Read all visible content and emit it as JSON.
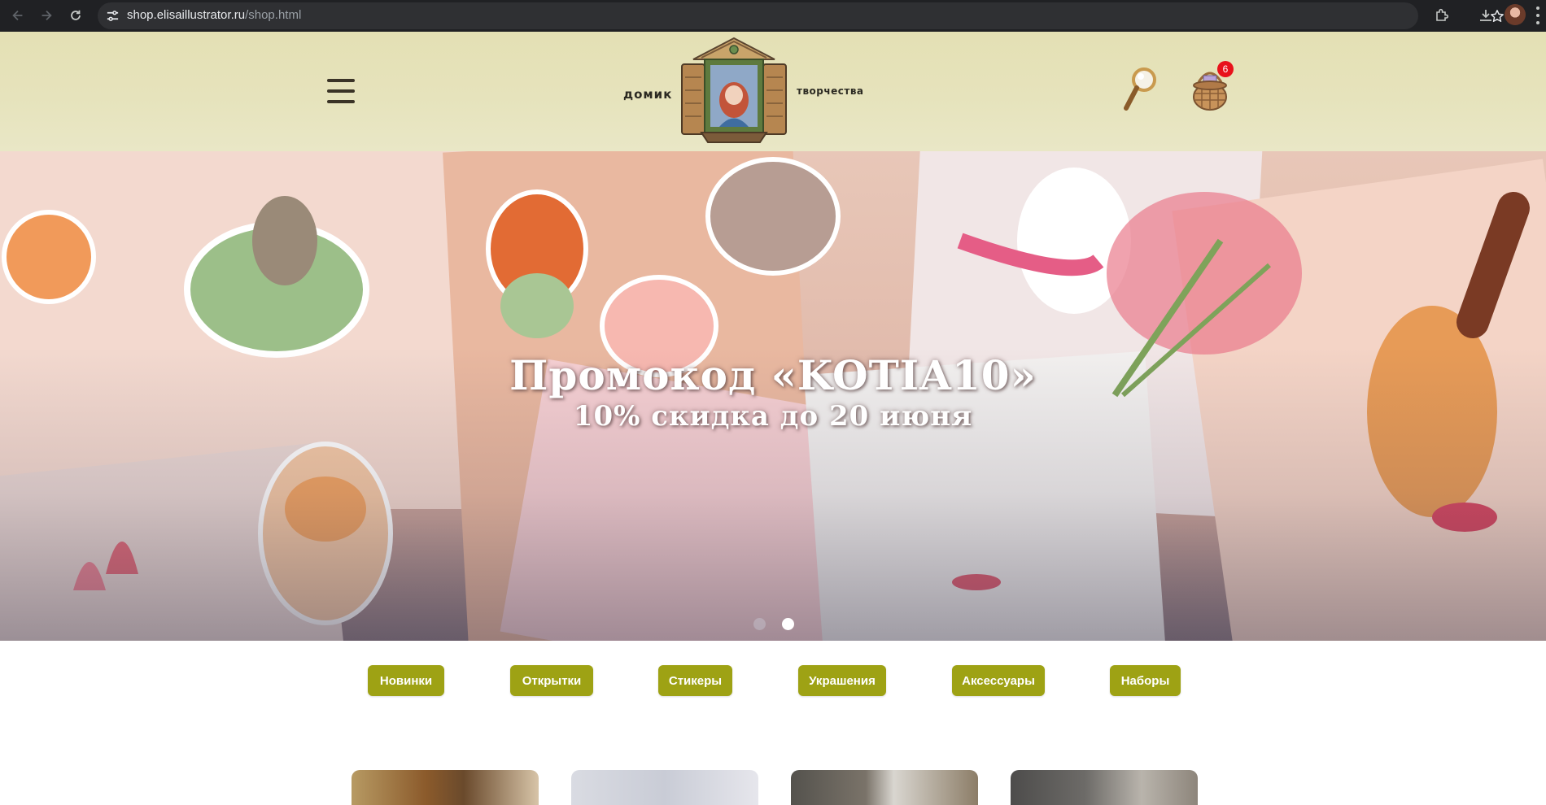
{
  "browser": {
    "url_host": "shop.elisaillustrator.ru",
    "url_path": "/shop.html",
    "icons": [
      "back-arrow-icon",
      "forward-arrow-icon",
      "reload-icon",
      "site-settings-icon",
      "bookmark-star-icon",
      "extensions-icon",
      "download-icon",
      "profile-avatar",
      "more-menu-icon"
    ]
  },
  "header": {
    "logo_left": "домик",
    "logo_right": "творчества",
    "cart_count": "6",
    "icons": [
      "hamburger-menu-icon",
      "magnifier-search-icon",
      "basket-cart-icon"
    ]
  },
  "hero": {
    "title": "Промокод «KOTIA10»",
    "subtitle": "10% скидка до 20 июня",
    "slides_total": 2,
    "active_slide": 2
  },
  "categories": [
    "Новинки",
    "Открытки",
    "Стикеры",
    "Украшения",
    "Аксессуары",
    "Наборы"
  ],
  "colors": {
    "chrome_bg": "#202124",
    "header_bg": "#e6e3bc",
    "category_button": "#9ea214",
    "badge": "#e8121b"
  }
}
